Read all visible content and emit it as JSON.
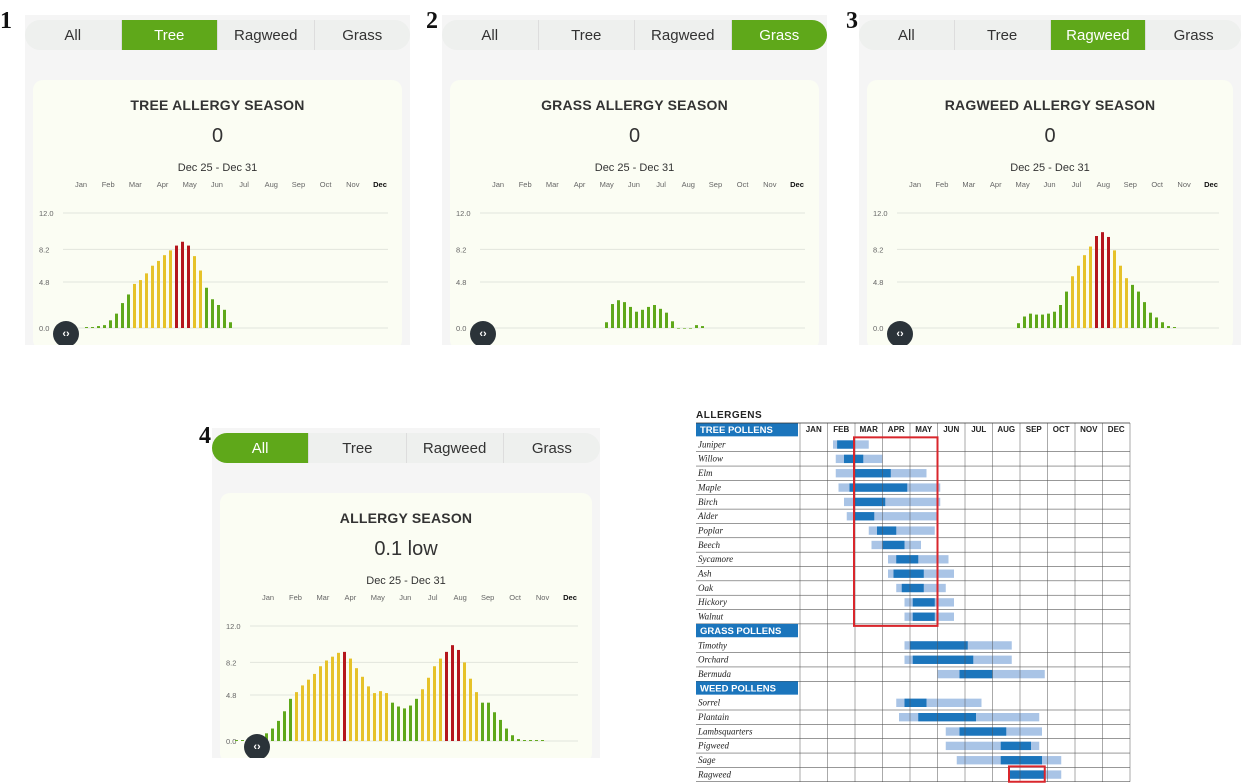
{
  "tab_labels": [
    "All",
    "Tree",
    "Ragweed",
    "Grass"
  ],
  "months": [
    "Jan",
    "Feb",
    "Mar",
    "Apr",
    "May",
    "Jun",
    "Jul",
    "Aug",
    "Sep",
    "Oct",
    "Nov",
    "Dec"
  ],
  "yticks": [
    "12.0",
    "8.2",
    "4.8",
    "0.0"
  ],
  "panels": [
    {
      "num": "1",
      "active": 1,
      "title": "TREE ALLERGY SEASON",
      "value": "0",
      "range": "Dec 25 - Dec 31"
    },
    {
      "num": "2",
      "active": 3,
      "title": "GRASS ALLERGY SEASON",
      "value": "0",
      "range": "Dec 25 - Dec 31"
    },
    {
      "num": "3",
      "active": 2,
      "title": "RAGWEED ALLERGY SEASON",
      "value": "0",
      "range": "Dec 25 - Dec 31"
    },
    {
      "num": "4",
      "active": 0,
      "title": "ALLERGY SEASON",
      "value": "0.1 low",
      "range": "Dec 25 - Dec 31"
    }
  ],
  "colors": {
    "green": "#5fa81a",
    "yellow": "#e6c229",
    "red": "#b5161d",
    "tab_active": "#5fa81a",
    "allergen_blue": "#1b75bc",
    "allergen_light": "#a9c4e6",
    "highlight": "#d9262c"
  },
  "chart_data": [
    {
      "type": "bar",
      "title": "TREE ALLERGY SEASON",
      "ylim": [
        0,
        12
      ],
      "yticks": [
        0,
        4.8,
        8.2,
        12
      ],
      "x": [
        "Jan",
        "Feb",
        "Mar",
        "Apr",
        "May",
        "Jun",
        "Jul",
        "Aug",
        "Sep",
        "Oct",
        "Nov",
        "Dec"
      ],
      "values": [
        0.1,
        0.1,
        0.2,
        0.3,
        0.8,
        1.5,
        2.6,
        3.5,
        4.6,
        5.0,
        5.7,
        6.5,
        7.0,
        7.6,
        8.1,
        8.6,
        9.0,
        8.6,
        7.5,
        6.0,
        4.2,
        3.0,
        2.4,
        1.9,
        0.6
      ]
    },
    {
      "type": "bar",
      "title": "GRASS ALLERGY SEASON",
      "ylim": [
        0,
        12
      ],
      "yticks": [
        0,
        4.8,
        8.2,
        12
      ],
      "values": [
        0.6,
        2.5,
        2.9,
        2.7,
        2.2,
        1.7,
        1.9,
        2.2,
        2.4,
        2.0,
        1.6,
        0.7,
        0,
        0,
        0,
        0.3,
        0.2
      ]
    },
    {
      "type": "bar",
      "title": "RAGWEED ALLERGY SEASON",
      "ylim": [
        0,
        12
      ],
      "yticks": [
        0,
        4.8,
        8.2,
        12
      ],
      "values": [
        0.5,
        1.2,
        1.5,
        1.4,
        1.4,
        1.5,
        1.7,
        2.4,
        3.8,
        5.4,
        6.5,
        7.6,
        8.5,
        9.6,
        10.0,
        9.5,
        8.1,
        6.5,
        5.2,
        4.5,
        3.8,
        2.7,
        1.6,
        1.1,
        0.6,
        0.2,
        0.1
      ]
    },
    {
      "type": "bar",
      "title": "ALLERGY SEASON",
      "ylim": [
        0,
        12
      ],
      "yticks": [
        0,
        4.8,
        8.2,
        12
      ],
      "values": [
        0.1,
        0.1,
        0.2,
        0.3,
        0.5,
        0.8,
        1.3,
        2.1,
        3.1,
        4.4,
        5.1,
        5.8,
        6.4,
        7.0,
        7.8,
        8.4,
        8.8,
        9.2,
        9.3,
        8.6,
        7.6,
        6.7,
        5.7,
        5.0,
        5.2,
        5.0,
        4.0,
        3.6,
        3.4,
        3.7,
        4.4,
        5.4,
        6.6,
        7.8,
        8.6,
        9.3,
        10.0,
        9.5,
        8.2,
        6.5,
        5.1,
        4.0,
        4.0,
        3.0,
        2.2,
        1.3,
        0.6,
        0.2,
        0.1,
        0.1,
        0.1,
        0.1
      ]
    },
    {
      "type": "gantt",
      "title": "ALLERGENS",
      "months": [
        "JAN",
        "FEB",
        "MAR",
        "APR",
        "MAY",
        "JUN",
        "JUL",
        "AUG",
        "SEP",
        "OCT",
        "NOV",
        "DEC"
      ],
      "groups": [
        {
          "name": "TREE POLLENS",
          "items": [
            {
              "name": "Juniper",
              "light": [
                1.2,
                2.5
              ],
              "dark": [
                1.35,
                2.0
              ]
            },
            {
              "name": "Willow",
              "light": [
                1.3,
                3.0
              ],
              "dark": [
                1.6,
                2.3
              ]
            },
            {
              "name": "Elm",
              "light": [
                1.3,
                4.6
              ],
              "dark": [
                2.0,
                3.3
              ]
            },
            {
              "name": "Maple",
              "light": [
                1.4,
                5.1
              ],
              "dark": [
                1.8,
                3.9
              ]
            },
            {
              "name": "Birch",
              "light": [
                1.6,
                5.1
              ],
              "dark": [
                2.0,
                3.1
              ]
            },
            {
              "name": "Alder",
              "light": [
                1.7,
                5.0
              ],
              "dark": [
                2.0,
                2.7
              ]
            },
            {
              "name": "Poplar",
              "light": [
                2.5,
                4.9
              ],
              "dark": [
                2.8,
                3.5
              ]
            },
            {
              "name": "Beech",
              "light": [
                2.6,
                4.4
              ],
              "dark": [
                3.0,
                3.8
              ]
            },
            {
              "name": "Sycamore",
              "light": [
                3.2,
                5.4
              ],
              "dark": [
                3.5,
                4.3
              ]
            },
            {
              "name": "Ash",
              "light": [
                3.2,
                5.6
              ],
              "dark": [
                3.4,
                4.5
              ]
            },
            {
              "name": "Oak",
              "light": [
                3.5,
                5.3
              ],
              "dark": [
                3.7,
                4.5
              ]
            },
            {
              "name": "Hickory",
              "light": [
                3.8,
                5.6
              ],
              "dark": [
                4.1,
                4.9
              ]
            },
            {
              "name": "Walnut",
              "light": [
                3.8,
                5.6
              ],
              "dark": [
                4.1,
                4.9
              ]
            }
          ]
        },
        {
          "name": "GRASS POLLENS",
          "items": [
            {
              "name": "Timothy",
              "light": [
                3.8,
                7.7
              ],
              "dark": [
                4.0,
                6.1
              ]
            },
            {
              "name": "Orchard",
              "light": [
                3.8,
                7.7
              ],
              "dark": [
                4.1,
                6.3
              ]
            },
            {
              "name": "Bermuda",
              "light": [
                5.0,
                8.9
              ],
              "dark": [
                5.8,
                7.0
              ]
            }
          ]
        },
        {
          "name": "WEED POLLENS",
          "items": [
            {
              "name": "Sorrel",
              "light": [
                3.5,
                6.6
              ],
              "dark": [
                3.8,
                4.6
              ]
            },
            {
              "name": "Plantain",
              "light": [
                3.6,
                8.7
              ],
              "dark": [
                4.3,
                6.4
              ]
            },
            {
              "name": "Lambsquarters",
              "light": [
                5.3,
                8.8
              ],
              "dark": [
                5.8,
                7.5
              ]
            },
            {
              "name": "Pigweed",
              "light": [
                5.3,
                8.7
              ],
              "dark": [
                7.3,
                8.4
              ]
            },
            {
              "name": "Sage",
              "light": [
                5.7,
                9.5
              ],
              "dark": [
                7.3,
                8.8
              ]
            },
            {
              "name": "Ragweed",
              "light": [
                7.6,
                9.5
              ],
              "dark": [
                7.6,
                8.9
              ]
            }
          ]
        }
      ]
    }
  ]
}
